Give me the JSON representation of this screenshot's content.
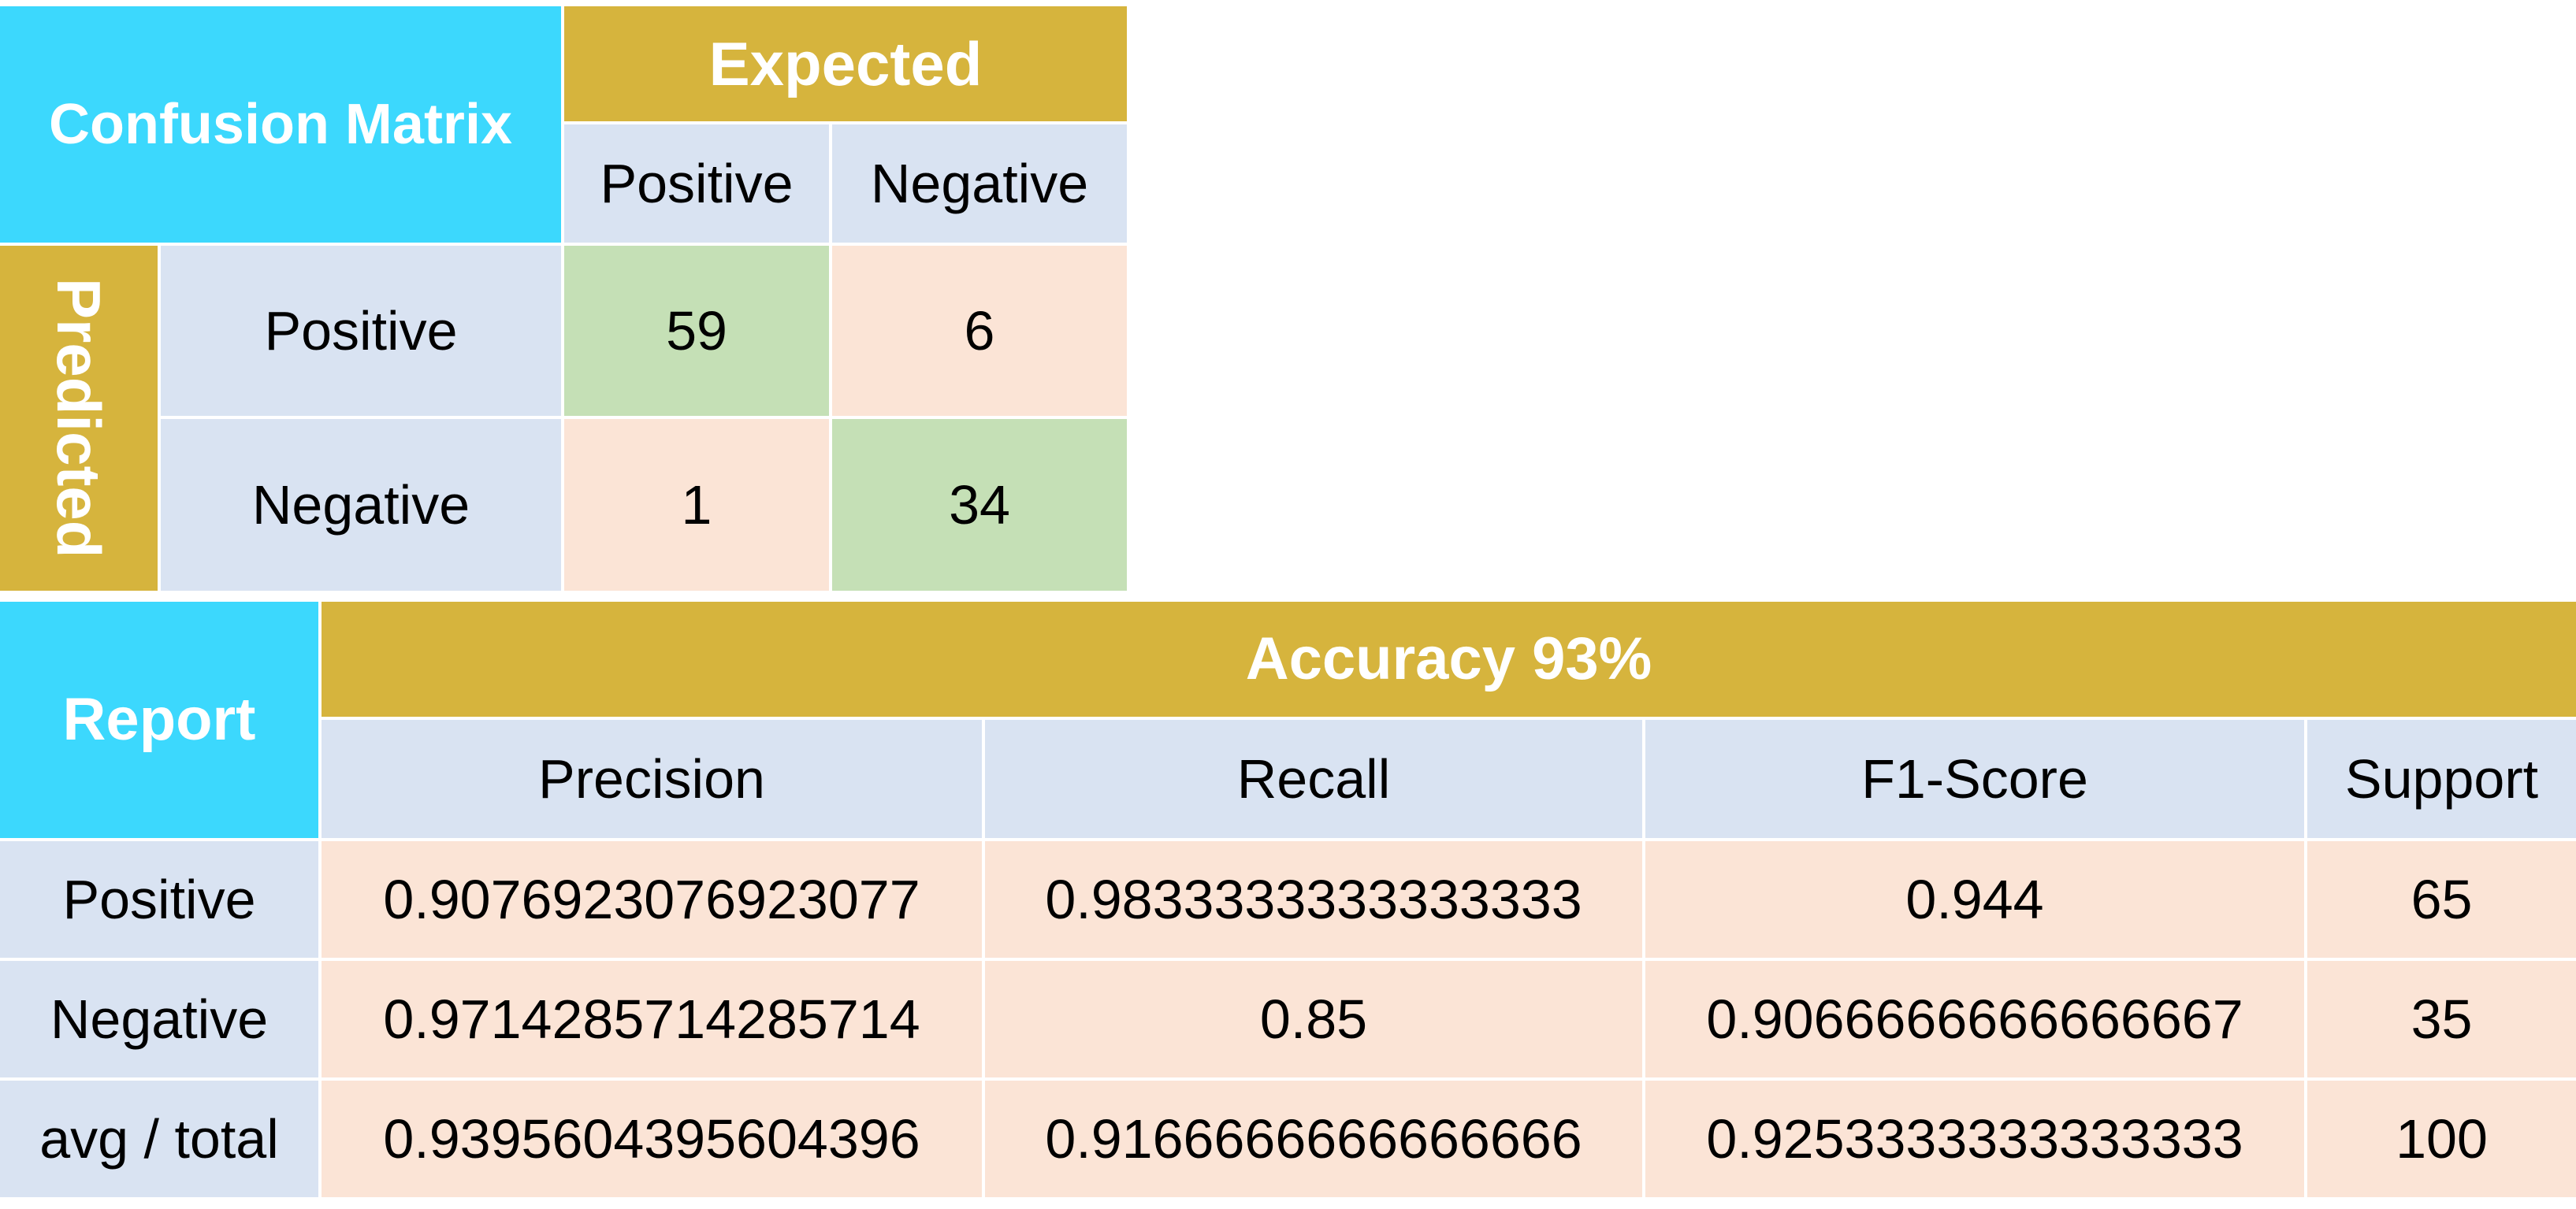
{
  "confusion_matrix": {
    "title": "Confusion Matrix",
    "expected_label": "Expected",
    "predicted_label": "Predicted",
    "col_headers": [
      "Positive",
      "Negative"
    ],
    "row_headers": [
      "Positive",
      "Negative"
    ],
    "cells": [
      [
        "59",
        "6"
      ],
      [
        "1",
        "34"
      ]
    ]
  },
  "report": {
    "title": "Report",
    "accuracy_label": "Accuracy 93%",
    "col_headers": [
      "Precision",
      "Recall",
      "F1-Score",
      "Support"
    ],
    "rows": [
      {
        "label": "Positive",
        "values": [
          "0.9076923076923077",
          "0.9833333333333333",
          "0.944",
          "65"
        ]
      },
      {
        "label": "Negative",
        "values": [
          "0.9714285714285714",
          "0.85",
          "0.9066666666666667",
          "35"
        ]
      },
      {
        "label": "avg / total",
        "values": [
          "0.9395604395604396",
          "0.9166666666666666",
          "0.9253333333333333",
          "100"
        ]
      }
    ]
  },
  "colors": {
    "header_cyan": "#3cd8fd",
    "header_gold": "#d6b43d",
    "label_blue": "#d9e3f2",
    "value_peach": "#fbe4d6",
    "correct_green": "#c5e0b6"
  }
}
